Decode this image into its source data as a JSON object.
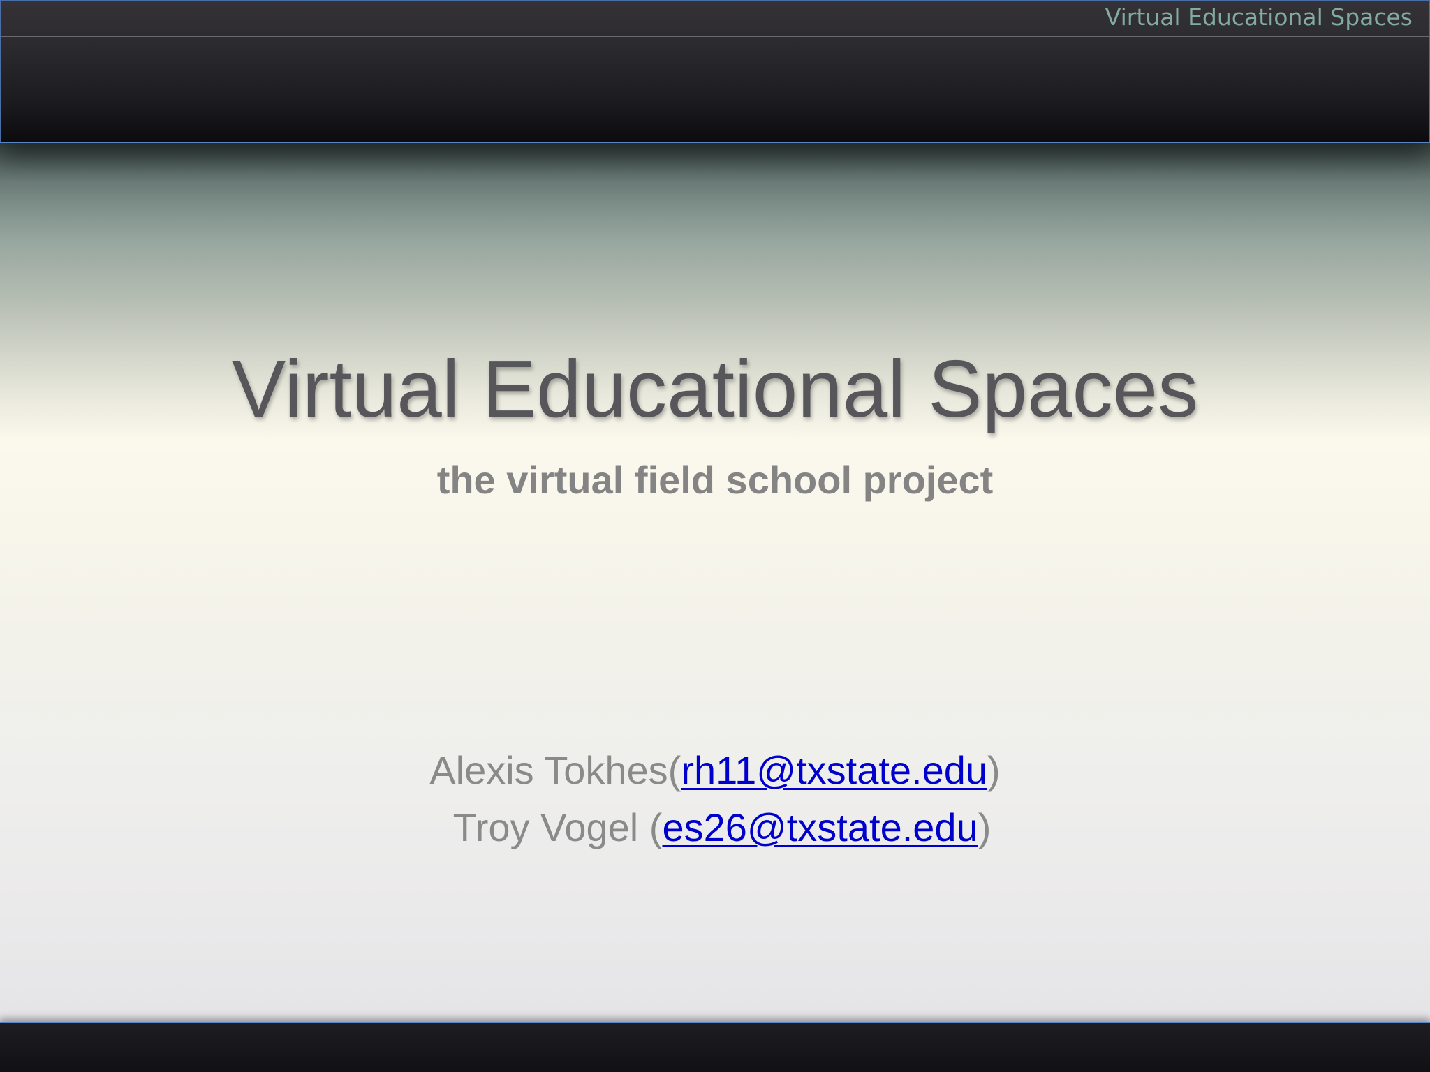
{
  "header": {
    "title": "Virtual Educational Spaces"
  },
  "slide": {
    "title": "Virtual Educational Spaces",
    "subtitle": "the virtual field school project",
    "authors": [
      {
        "name": "Alexis Tokhes",
        "prefix": "(",
        "email": "rh11@txstate.edu",
        "suffix": ")"
      },
      {
        "name": "Troy Vogel",
        "prefix": " (",
        "email": "es26@txstate.edu",
        "suffix": ")"
      }
    ]
  },
  "colors": {
    "header_text": "#82aca3",
    "title_text": "#57575b",
    "subtitle_text": "#858485",
    "link": "#0000cc",
    "band_border": "#5a86c8"
  }
}
